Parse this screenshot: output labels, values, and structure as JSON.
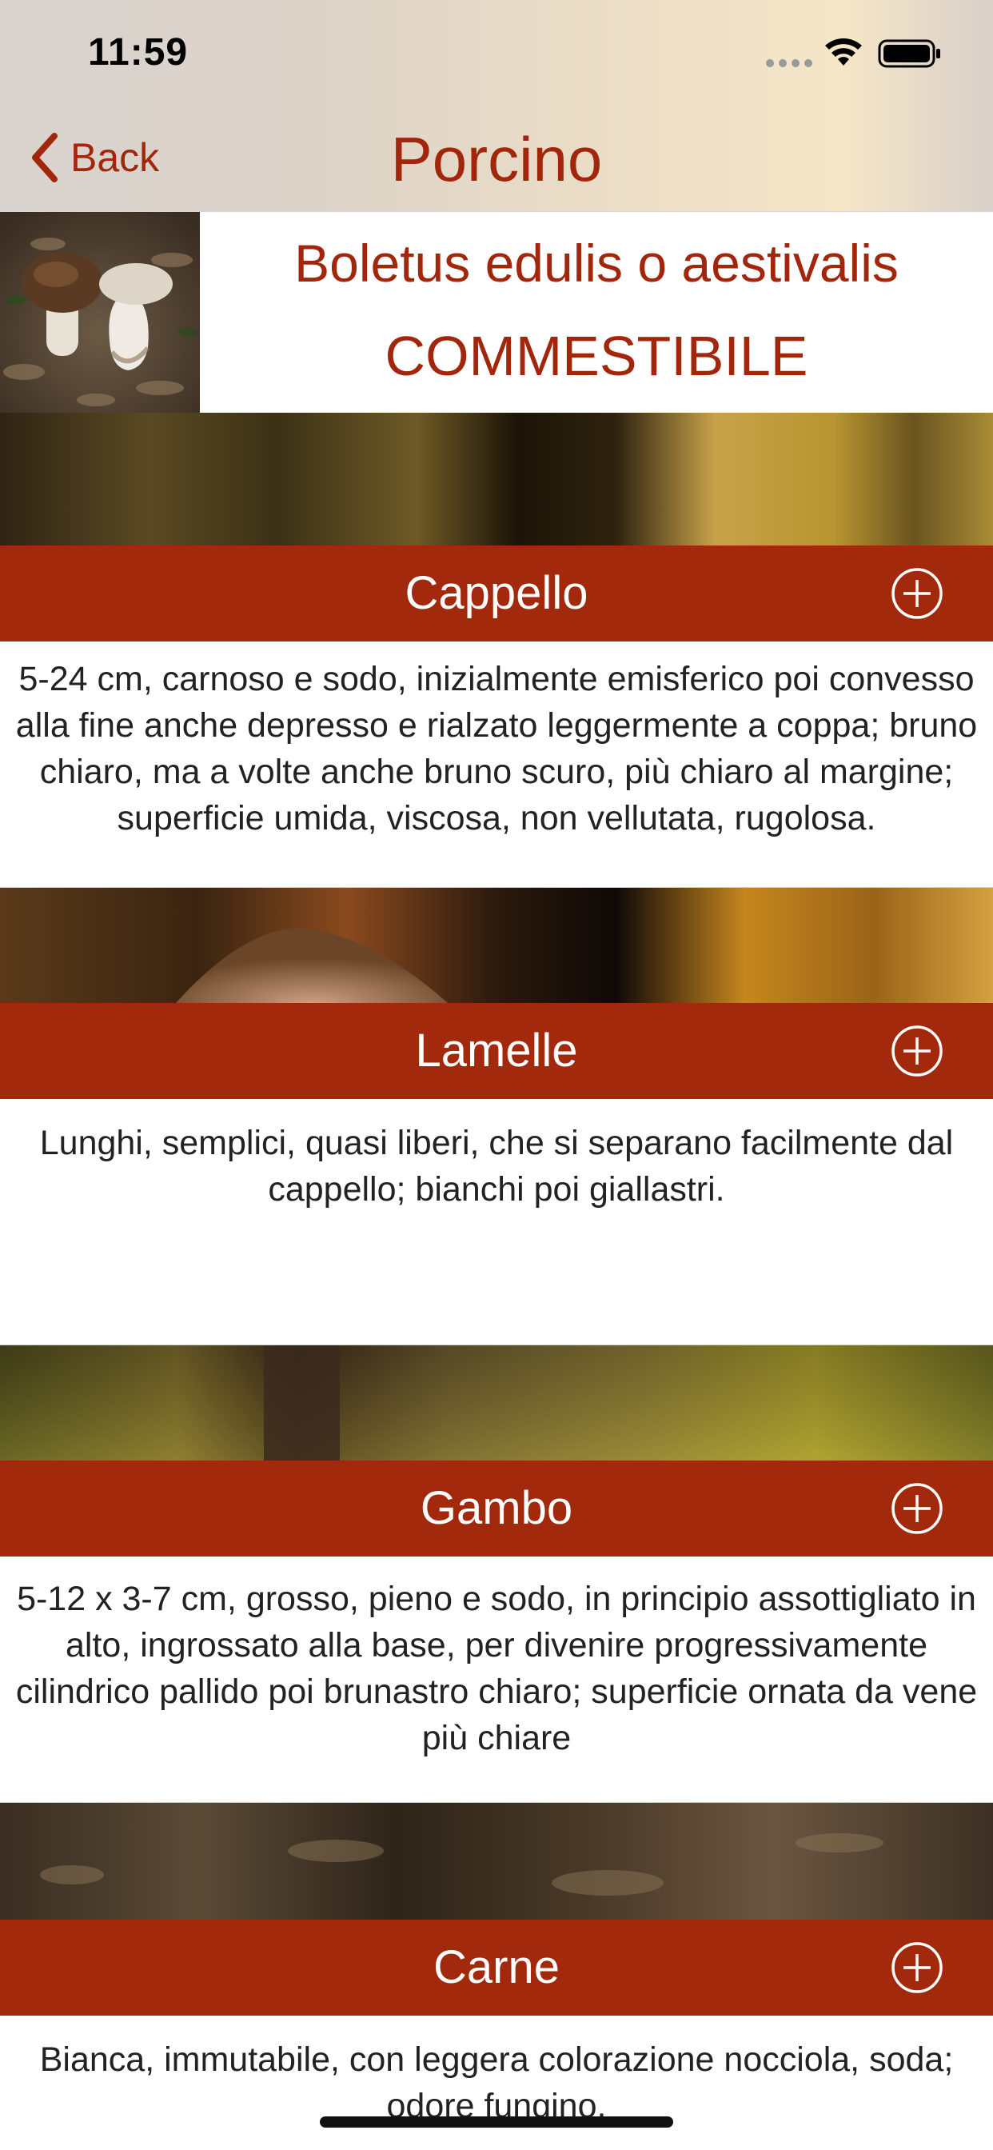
{
  "status_bar": {
    "time": "11:59",
    "icons": [
      "cellular-signal-icon",
      "wifi-icon",
      "battery-icon"
    ]
  },
  "nav": {
    "back_label": "Back",
    "title": "Porcino",
    "back_icon": "chevron-left-icon"
  },
  "header": {
    "image": "mushroom-photo",
    "species": "Boletus edulis o aestivalis",
    "edibility": "COMMESTIBILE"
  },
  "sections": [
    {
      "title": "Cappello",
      "text": "5-24 cm, carnoso e sodo, inizialmente emisferico poi convesso alla fine anche depresso e rialzato leggermente a coppa; bruno chiaro, ma a volte anche bruno scuro, più chiaro al margine; superficie umida, viscosa, non vellutata, rugolosa."
    },
    {
      "title": "Lamelle",
      "text": "Lunghi, semplici, quasi liberi, che si separano facilmente dal cappello; bianchi poi giallastri."
    },
    {
      "title": "Gambo",
      "text": "5-12 x 3-7 cm, grosso, pieno e sodo, in principio assottigliato in alto, ingrossato alla base, per divenire progressivamente cilindrico pallido poi brunastro chiaro; superficie ornata da vene più chiare"
    },
    {
      "title": "Carne",
      "text": "Bianca, immutabile, con leggera colorazione nocciola, soda; odore fungino."
    }
  ],
  "colors": {
    "accent": "#a2260c",
    "section_bar": "#a2290b",
    "text": "#222222"
  }
}
